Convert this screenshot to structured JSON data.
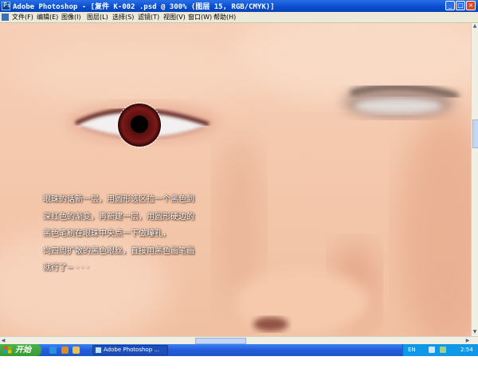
{
  "window": {
    "title": "Adobe Photoshop - [复件 K-002 .psd @ 300% (图层 15, RGB/CMYK)]",
    "buttons": {
      "minimize": "_",
      "maximize": "□",
      "close": "×"
    }
  },
  "menubar": {
    "items": [
      "文件(F)",
      "编辑(E)",
      "图像(I)",
      "图层(L)",
      "选择(S)",
      "滤镜(T)",
      "视图(V)",
      "窗口(W)",
      "帮助(H)"
    ]
  },
  "canvas": {
    "annotation_lines": [
      "眼珠的话新一层，用圆形选区拉一个黑色到",
      "深红色的渐变，再新建一层，用圆形硬边的",
      "黑色笔刷在眼珠中央点一下做瞳孔，",
      "向四周扩散的黑色眼丝，直接用黑色画笔画",
      "就行了~ · · ·"
    ]
  },
  "taskbar": {
    "start_label": "开始",
    "task_label": "Adobe Photoshop ...",
    "tray": {
      "language": "EN",
      "time": "2:54"
    }
  },
  "colors": {
    "titlebar": "#0a4fd0",
    "menubar": "#ece9d8",
    "skin": "#f3c8ad",
    "iris": "#6a1414",
    "taskbar": "#245edb",
    "start_green": "#3c9f3a"
  },
  "icons": [
    "photoshop-app-icon",
    "document-icon",
    "windows-flag-icon",
    "ie-icon",
    "media-icon",
    "folder-icon",
    "speaker-icon",
    "network-icon"
  ]
}
